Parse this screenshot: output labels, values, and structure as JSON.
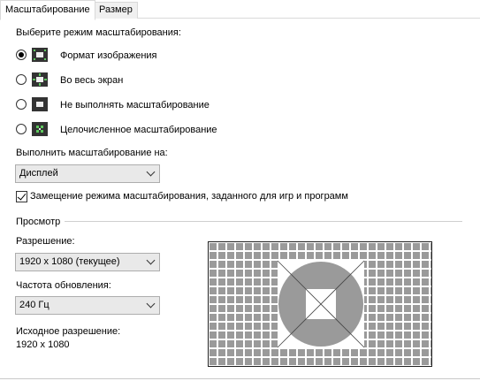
{
  "tabs": [
    {
      "label": "Масштабирование",
      "active": true
    },
    {
      "label": "Размер",
      "active": false
    }
  ],
  "mode_section": {
    "title": "Выберите режим масштабирования:",
    "options": [
      {
        "label": "Формат изображения",
        "checked": true,
        "icon": "aspect-ratio-icon"
      },
      {
        "label": "Во весь экран",
        "checked": false,
        "icon": "full-screen-icon"
      },
      {
        "label": "Не выполнять масштабирование",
        "checked": false,
        "icon": "no-scaling-icon"
      },
      {
        "label": "Целочисленное масштабирование",
        "checked": false,
        "icon": "integer-scaling-icon"
      }
    ]
  },
  "perform_on": {
    "label": "Выполнить масштабирование на:",
    "value": "Дисплей"
  },
  "override": {
    "label": "Замещение режима масштабирования, заданного для игр и программ",
    "checked": true
  },
  "preview": {
    "title": "Просмотр",
    "resolution_label": "Разрешение:",
    "resolution_value": "1920 x 1080 (текущее)",
    "refresh_label": "Частота обновления:",
    "refresh_value": "240 Гц",
    "native_label": "Исходное разрешение:",
    "native_value": "1920 x 1080"
  },
  "colors": {
    "icon_accent": "#5ec95e",
    "preview_grid_cell": "#9a9a9a",
    "preview_grid_line": "#ffffff"
  }
}
